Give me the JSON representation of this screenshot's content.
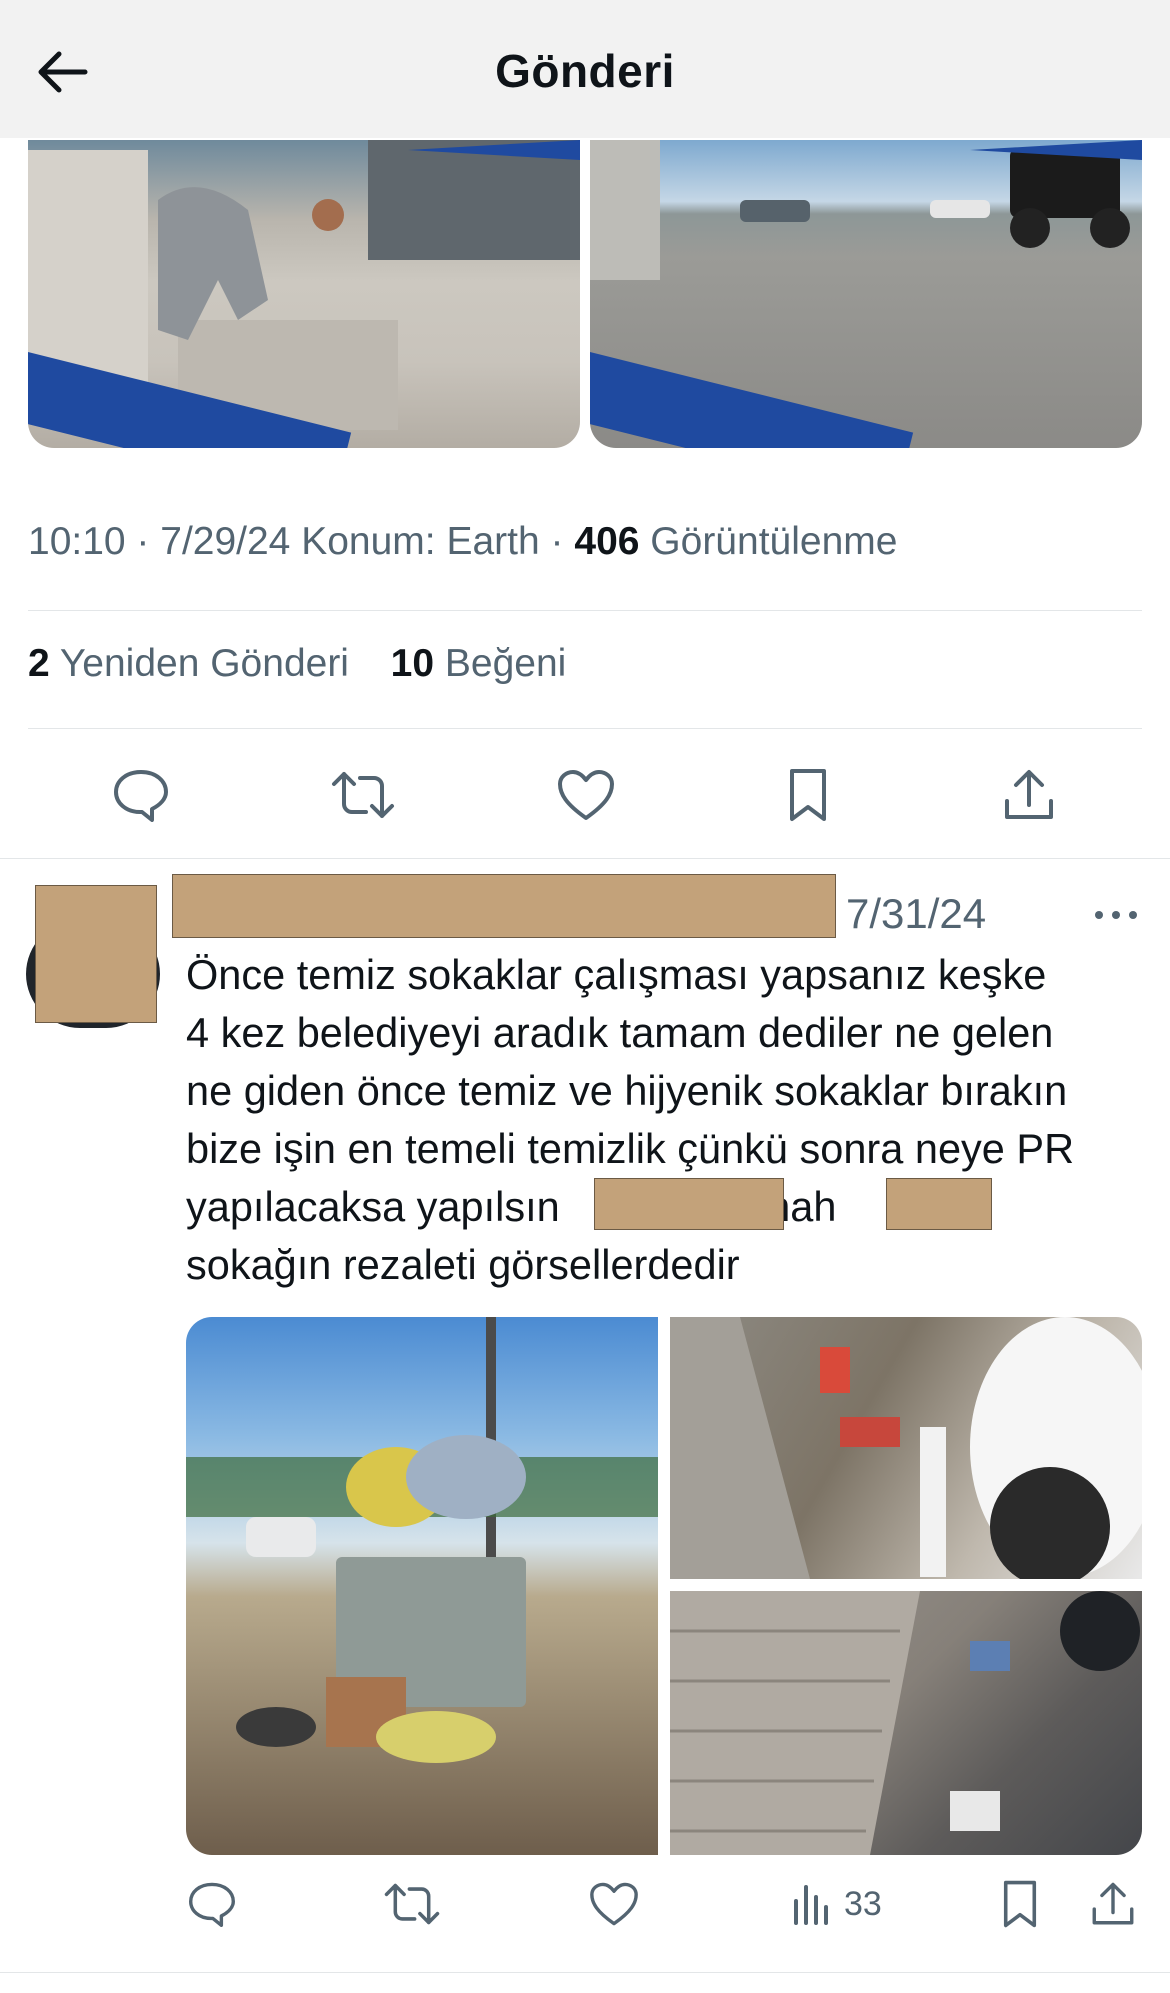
{
  "header": {
    "title": "Gönderi",
    "back_icon": "arrow-left-icon"
  },
  "main_post": {
    "images": [
      {
        "name": "paving-worker-photo",
        "caption_band_color": "#1f4aa0"
      },
      {
        "name": "paved-lot-photo",
        "caption_band_color": "#1f4aa0"
      }
    ],
    "meta": {
      "time_date": "10:10 · 7/29/24",
      "location": "Konum: Earth",
      "separator": "·",
      "views_count": "406",
      "views_label": "Görüntülenme"
    },
    "stats": {
      "reposts_count": "2",
      "reposts_label": "Yeniden Gönderi",
      "likes_count": "10",
      "likes_label": "Beğeni"
    },
    "actions": [
      "reply-icon",
      "repost-icon",
      "like-icon",
      "bookmark-icon",
      "share-icon"
    ]
  },
  "reply": {
    "date": "7/31/24",
    "more_icon": "more-dots-icon",
    "text_lines": {
      "l1": "Önce temiz sokaklar çalışması yapsanız keşke",
      "l2": "4 kez belediyeyi aradık tamam dediler ne gelen",
      "l3": "ne giden önce temiz ve hijyenik sokaklar bırakın",
      "l4": "bize işin en temeli temizlik çünkü sonra neye PR",
      "l5_a": "yapılacaksa yapılsın",
      "l5_b": "mah",
      "l6": "sokağın rezaleti görsellerdedir"
    },
    "images": [
      {
        "name": "overflowing-dumpster-photo"
      },
      {
        "name": "litter-curb-photo"
      },
      {
        "name": "litter-sidewalk-photo"
      }
    ],
    "actions": {
      "views_count": "33",
      "icons": [
        "reply-icon",
        "repost-icon",
        "like-icon",
        "views-icon",
        "bookmark-icon",
        "share-icon"
      ]
    }
  },
  "colors": {
    "text_primary": "#0f1419",
    "text_secondary": "#536471",
    "redaction": "#c3a27a",
    "header_bg": "#f2f2f2"
  }
}
